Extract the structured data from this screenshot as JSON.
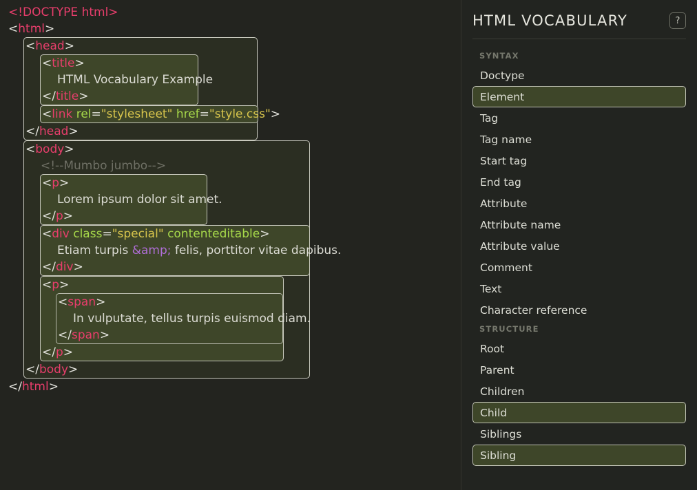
{
  "panel": {
    "title": "HTML VOCABULARY",
    "help_label": "?",
    "help_icon": "question-mark-icon",
    "groups": [
      {
        "label": "SYNTAX",
        "items": [
          {
            "label": "Doctype",
            "selected": false
          },
          {
            "label": "Element",
            "selected": true
          },
          {
            "label": "Tag",
            "selected": false
          },
          {
            "label": "Tag name",
            "selected": false
          },
          {
            "label": "Start tag",
            "selected": false
          },
          {
            "label": "End tag",
            "selected": false
          },
          {
            "label": "Attribute",
            "selected": false
          },
          {
            "label": "Attribute name",
            "selected": false
          },
          {
            "label": "Attribute value",
            "selected": false
          },
          {
            "label": "Comment",
            "selected": false
          },
          {
            "label": "Text",
            "selected": false
          },
          {
            "label": "Character reference",
            "selected": false
          }
        ]
      },
      {
        "label": "STRUCTURE",
        "items": [
          {
            "label": "Root",
            "selected": false
          },
          {
            "label": "Parent",
            "selected": false
          },
          {
            "label": "Children",
            "selected": false
          },
          {
            "label": "Child",
            "selected": true
          },
          {
            "label": "Siblings",
            "selected": false
          },
          {
            "label": "Sibling",
            "selected": true
          }
        ]
      }
    ]
  },
  "code": {
    "doctype": "<!DOCTYPE html>",
    "html_open": "<html>",
    "html_close": "</html>",
    "head_open": "<head>",
    "head_close": "</head>",
    "title_open": "<title>",
    "title_text": "HTML Vocabulary Example",
    "title_close": "</title>",
    "link_tag_open": "<",
    "link_tag_name": "link",
    "link_attr1_name": "rel",
    "link_attr1_value": "\"stylesheet\"",
    "link_attr2_name": "href",
    "link_attr2_value": "\"style.css\"",
    "link_tag_close": ">",
    "body_open": "<body>",
    "body_close": "</body>",
    "comment": "<!--Mumbo jumbo-->",
    "p1_open": "<p>",
    "p1_text": "Lorem ipsum dolor sit amet.",
    "p1_close": "</p>",
    "div_tag_open": "<",
    "div_tag_name": "div",
    "div_attr1_name": "class",
    "div_attr1_value": "\"special\"",
    "div_attr2_name": "contenteditable",
    "div_tag_close": ">",
    "div_text_before": "Etiam turpis ",
    "div_charref": "&amp;",
    "div_text_after": " felis, porttitor vitae dapibus.",
    "div_close": "</div>",
    "p2_open": "<p>",
    "span_open": "<span>",
    "span_text": "In vulputate, tellus turpis euismod diam.",
    "span_close": "</span>",
    "p2_close": "</p>",
    "lt": "<",
    "gt": ">",
    "lt_slash": "</",
    "name_html": "html",
    "name_head": "head",
    "name_title": "title",
    "name_body": "body",
    "name_p": "p",
    "name_div": "div",
    "name_span": "span"
  },
  "colors": {
    "page_bg": "#23241f",
    "panel_bg": "#222420",
    "selected_bg": "#3e4629",
    "element_box_bg": "#3e4629",
    "body_box_bg": "#2b2e22",
    "tag_color": "#e83e6c",
    "attr_name_color": "#a6d84a",
    "attr_value_color": "#d7c44c",
    "comment_color": "#6f7065",
    "charref_color": "#b06ed8",
    "text_color": "#dcdcd4"
  }
}
